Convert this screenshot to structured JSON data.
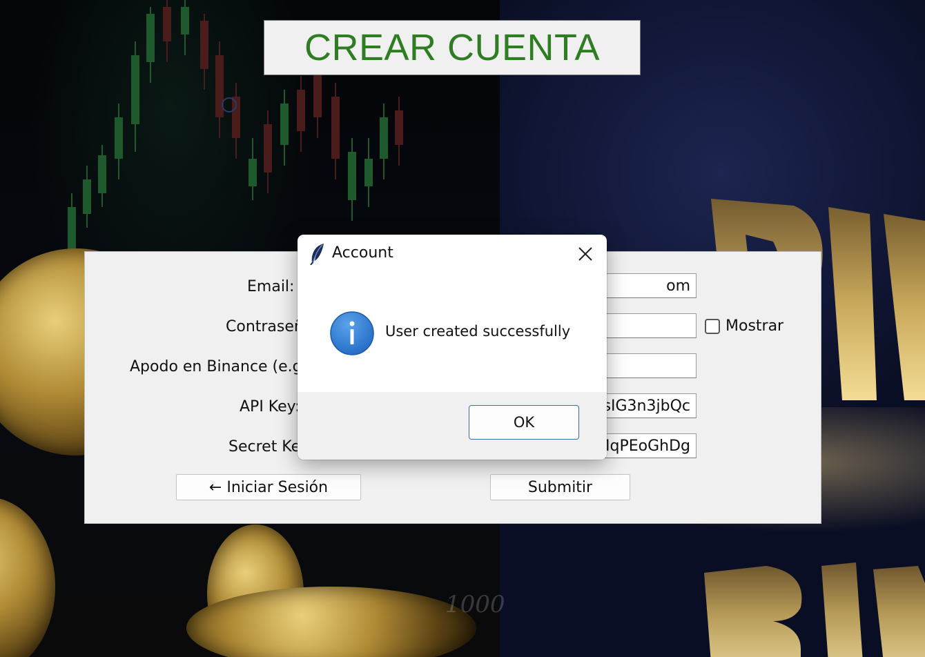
{
  "background": {
    "axis_value": "1000"
  },
  "title": "CREAR CUENTA",
  "form": {
    "email_label": "Email:",
    "email_value": "om",
    "password_label": "Contraseñ",
    "password_value": "",
    "show_label": "Mostrar",
    "nickname_label": "Apodo en Binance (e.g.",
    "nickname_value": "",
    "api_key_label": "API Key:",
    "api_key_value": "sIG3n3jbQc",
    "secret_key_label": "Secret Ke",
    "secret_key_value": "MqPEoGhDg",
    "login_button": "← Iniciar Sesión",
    "submit_button": "Submitir"
  },
  "dialog": {
    "title": "Account",
    "message": "User created successfully",
    "ok_button": "OK",
    "icon": "info-icon",
    "accent_color": "#2f6fb5"
  },
  "colors": {
    "title_text": "#2e7d22",
    "panel_bg": "#f0f0f0"
  }
}
